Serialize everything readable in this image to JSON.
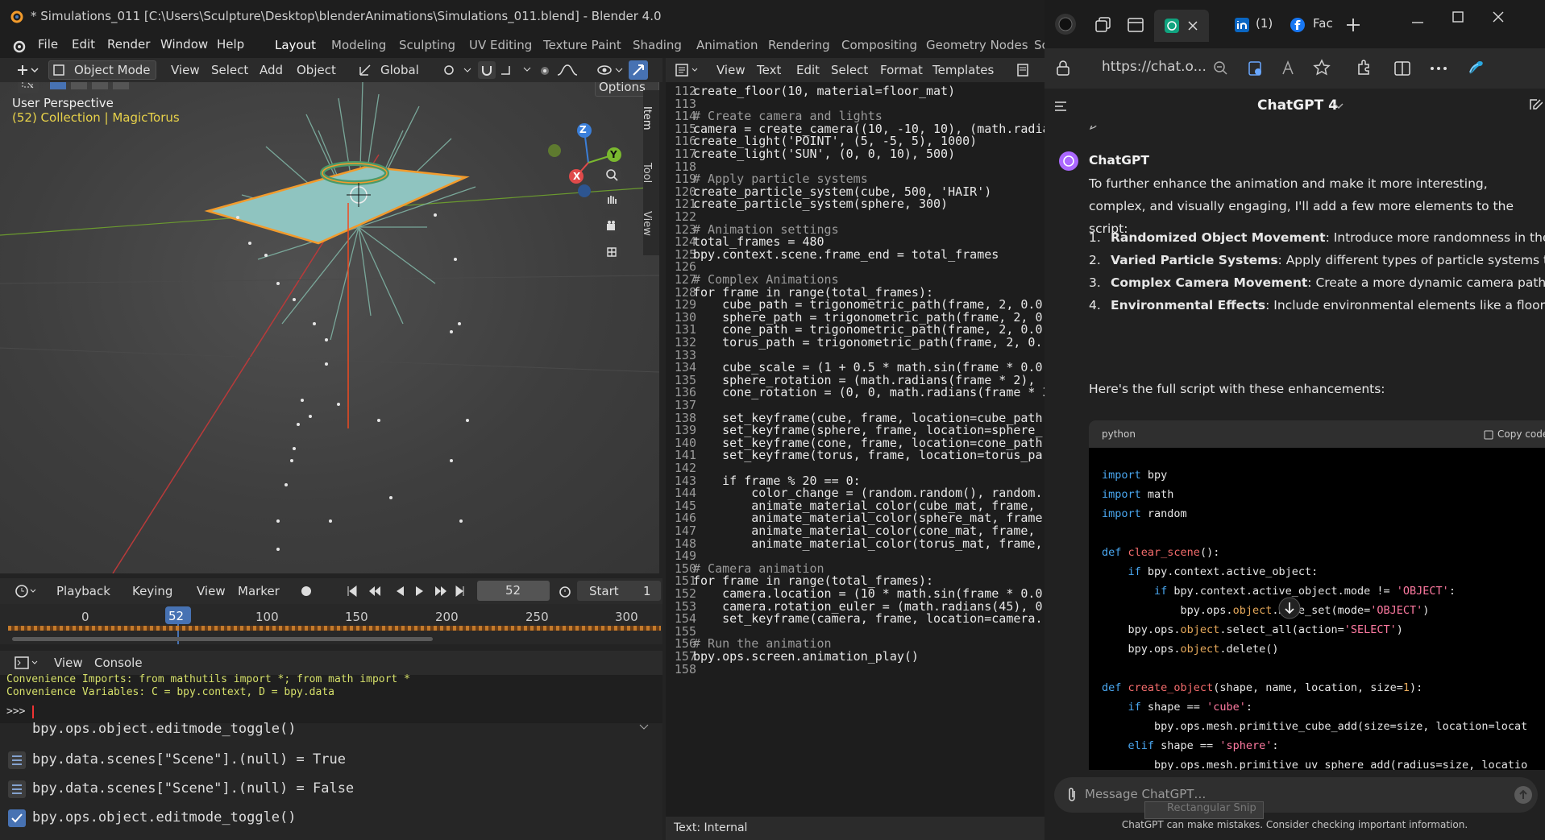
{
  "blender": {
    "title": "* Simulations_011 [C:\\Users\\Sculpture\\Desktop\\blenderAnimations\\Simulations_011.blend] - Blender 4.0",
    "menu": [
      "File",
      "Edit",
      "Render",
      "Window",
      "Help"
    ],
    "workspaces": [
      "Layout",
      "Modeling",
      "Sculpting",
      "UV Editing",
      "Texture Paint",
      "Shading",
      "Animation",
      "Rendering",
      "Compositing",
      "Geometry Nodes",
      "Sc"
    ],
    "viewport": {
      "mode": "Object Mode",
      "menus": [
        "View",
        "Select",
        "Add",
        "Object"
      ],
      "transform": "Global",
      "options": "Options",
      "perspective": "User Perspective",
      "collection": "(52) Collection | MagicTorus",
      "side_tabs": [
        "Item",
        "Tool",
        "View"
      ],
      "axes": {
        "z": "Z",
        "y": "Y",
        "x": "X"
      }
    },
    "timeline": {
      "menus": [
        "Playback",
        "Keying",
        "View",
        "Marker"
      ],
      "current_frame": "52",
      "start_label": "Start",
      "start_value": "1",
      "ticks": [
        "0",
        "52",
        "100",
        "150",
        "200",
        "250",
        "300"
      ]
    },
    "console": {
      "menus": [
        "View",
        "Console"
      ],
      "line1": "Convenience Imports:   from mathutils import *; from math import *",
      "line2": "Convenience Variables: C = bpy.context, D = bpy.data",
      "prompt": ">>> "
    },
    "info_log": [
      "bpy.ops.object.editmode_toggle()",
      "bpy.data.scenes[\"Scene\"].(null) = True",
      "bpy.data.scenes[\"Scene\"].(null) = False",
      "bpy.ops.object.editmode_toggle()"
    ],
    "text_editor": {
      "menus": [
        "View",
        "Text",
        "Edit",
        "Select",
        "Format",
        "Templates"
      ],
      "footer": "Text: Internal",
      "lines": [
        {
          "n": "112",
          "t": "create_floor(10, material=floor_mat)"
        },
        {
          "n": "113",
          "t": ""
        },
        {
          "n": "114",
          "t": "# Create camera and lights"
        },
        {
          "n": "115",
          "t": "camera = create_camera((10, -10, 10), (math.radia"
        },
        {
          "n": "116",
          "t": "create_light('POINT', (5, -5, 5), 1000)"
        },
        {
          "n": "117",
          "t": "create_light('SUN', (0, 0, 10), 500)"
        },
        {
          "n": "118",
          "t": ""
        },
        {
          "n": "119",
          "t": "# Apply particle systems"
        },
        {
          "n": "120",
          "t": "create_particle_system(cube, 500, 'HAIR')"
        },
        {
          "n": "121",
          "t": "create_particle_system(sphere, 300)"
        },
        {
          "n": "122",
          "t": ""
        },
        {
          "n": "123",
          "t": "# Animation settings"
        },
        {
          "n": "124",
          "t": "total_frames = 480"
        },
        {
          "n": "125",
          "t": "bpy.context.scene.frame_end = total_frames"
        },
        {
          "n": "126",
          "t": ""
        },
        {
          "n": "127",
          "t": "# Complex Animations"
        },
        {
          "n": "128",
          "t": "for frame in range(total_frames):"
        },
        {
          "n": "129",
          "t": "    cube_path = trigonometric_path(frame, 2, 0.0"
        },
        {
          "n": "130",
          "t": "    sphere_path = trigonometric_path(frame, 2, 0"
        },
        {
          "n": "131",
          "t": "    cone_path = trigonometric_path(frame, 2, 0.0"
        },
        {
          "n": "132",
          "t": "    torus_path = trigonometric_path(frame, 2, 0.("
        },
        {
          "n": "133",
          "t": ""
        },
        {
          "n": "134",
          "t": "    cube_scale = (1 + 0.5 * math.sin(frame * 0.0"
        },
        {
          "n": "135",
          "t": "    sphere_rotation = (math.radians(frame * 2), "
        },
        {
          "n": "136",
          "t": "    cone_rotation = (0, 0, math.radians(frame * 3"
        },
        {
          "n": "137",
          "t": ""
        },
        {
          "n": "138",
          "t": "    set_keyframe(cube, frame, location=cube_path"
        },
        {
          "n": "139",
          "t": "    set_keyframe(sphere, frame, location=sphere_"
        },
        {
          "n": "140",
          "t": "    set_keyframe(cone, frame, location=cone_path"
        },
        {
          "n": "141",
          "t": "    set_keyframe(torus, frame, location=torus_pa"
        },
        {
          "n": "142",
          "t": ""
        },
        {
          "n": "143",
          "t": "    if frame % 20 == 0:"
        },
        {
          "n": "144",
          "t": "        color_change = (random.random(), random."
        },
        {
          "n": "145",
          "t": "        animate_material_color(cube_mat, frame, "
        },
        {
          "n": "146",
          "t": "        animate_material_color(sphere_mat, frame"
        },
        {
          "n": "147",
          "t": "        animate_material_color(cone_mat, frame, "
        },
        {
          "n": "148",
          "t": "        animate_material_color(torus_mat, frame, "
        },
        {
          "n": "149",
          "t": ""
        },
        {
          "n": "150",
          "t": "# Camera animation"
        },
        {
          "n": "151",
          "t": "for frame in range(total_frames):"
        },
        {
          "n": "152",
          "t": "    camera.location = (10 * math.sin(frame * 0.0"
        },
        {
          "n": "153",
          "t": "    camera.rotation_euler = (math.radians(45), 0"
        },
        {
          "n": "154",
          "t": "    set_keyframe(camera, frame, location=camera."
        },
        {
          "n": "155",
          "t": ""
        },
        {
          "n": "156",
          "t": "# Run the animation"
        },
        {
          "n": "157",
          "t": "bpy.ops.screen.animation_play()"
        },
        {
          "n": "158",
          "t": ""
        }
      ]
    }
  },
  "browser": {
    "tab_count": "(1)",
    "tab_fb": "Fac",
    "url": "https://chat.o...",
    "chat_title": "ChatGPT 4",
    "sender": "ChatGPT",
    "intro": "To further enhance the animation and make it more interesting, complex, and visually engaging, I'll add a few more elements to the script:",
    "list": [
      {
        "b": "Randomized Object Movement",
        "t": ": Introduce more randomness in the movement of objects."
      },
      {
        "b": "Varied Particle Systems",
        "t": ": Apply different types of particle systems to each obje"
      },
      {
        "b": "Complex Camera Movement",
        "t": ": Create a more dynamic camera path."
      },
      {
        "b": "Environmental Effects",
        "t": ": Include environmental elements like a floor plane with a reflective material."
      }
    ],
    "outro": "Here's the full script with these enhancements:",
    "code_lang": "python",
    "copy_label": "Copy code",
    "input_placeholder": "Message ChatGPT…",
    "snip_tooltip": "Rectangular Snip",
    "disclaimer": "ChatGPT can make mistakes. Consider checking important information."
  },
  "colors": {
    "accent_blue": "#4772b3",
    "orange": "#f29b2c",
    "grid_red": "#b93a3a",
    "grid_green": "#6b9a2f"
  }
}
